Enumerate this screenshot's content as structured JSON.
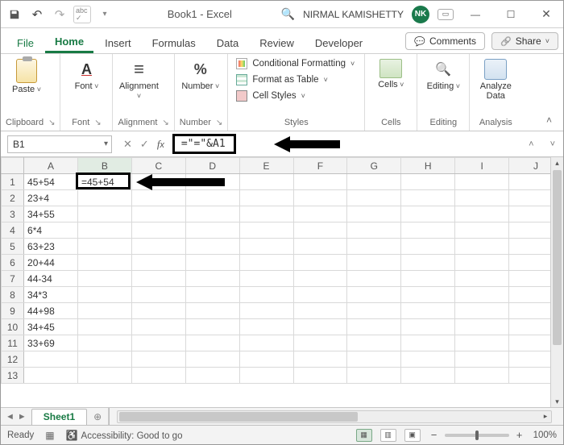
{
  "title": "Book1 - Excel",
  "user": {
    "name": "NIRMAL KAMISHETTY",
    "initials": "NK"
  },
  "qat": {
    "autosave": "abc ✓"
  },
  "tabs": {
    "file": "File",
    "items": [
      "Home",
      "Insert",
      "Formulas",
      "Data",
      "Review",
      "Developer"
    ],
    "active": 0,
    "comments": "Comments",
    "share": "Share"
  },
  "ribbon": {
    "clipboard": {
      "label": "Clipboard",
      "paste": "Paste"
    },
    "font": {
      "label": "Font",
      "btn": "Font"
    },
    "alignment": {
      "label": "Alignment",
      "btn": "Alignment"
    },
    "number": {
      "label": "Number",
      "btn": "Number"
    },
    "styles": {
      "label": "Styles",
      "cond": "Conditional Formatting",
      "table": "Format as Table",
      "cell": "Cell Styles"
    },
    "cells": {
      "label": "Cells",
      "btn": "Cells"
    },
    "editing": {
      "label": "Editing",
      "btn": "Editing"
    },
    "analysis": {
      "label": "Analysis",
      "btn1": "Analyze",
      "btn2": "Data"
    }
  },
  "namebox": "B1",
  "formula": "=\"=\"&A1",
  "columns": [
    "A",
    "B",
    "C",
    "D",
    "E",
    "F",
    "G",
    "H",
    "I",
    "J"
  ],
  "rows": [
    {
      "n": 1,
      "A": "45+54",
      "B": "=45+54"
    },
    {
      "n": 2,
      "A": "23+4"
    },
    {
      "n": 3,
      "A": "34+55"
    },
    {
      "n": 4,
      "A": "6*4"
    },
    {
      "n": 5,
      "A": "63+23"
    },
    {
      "n": 6,
      "A": "20+44"
    },
    {
      "n": 7,
      "A": "44-34"
    },
    {
      "n": 8,
      "A": "34*3"
    },
    {
      "n": 9,
      "A": "44+98"
    },
    {
      "n": 10,
      "A": "34+45"
    },
    {
      "n": 11,
      "A": "33+69"
    },
    {
      "n": 12
    },
    {
      "n": 13
    }
  ],
  "active_cell": {
    "row": 1,
    "col": "B"
  },
  "sheet_tab": "Sheet1",
  "status": {
    "ready": "Ready",
    "accessibility": "Accessibility: Good to go",
    "zoom": "100%"
  }
}
